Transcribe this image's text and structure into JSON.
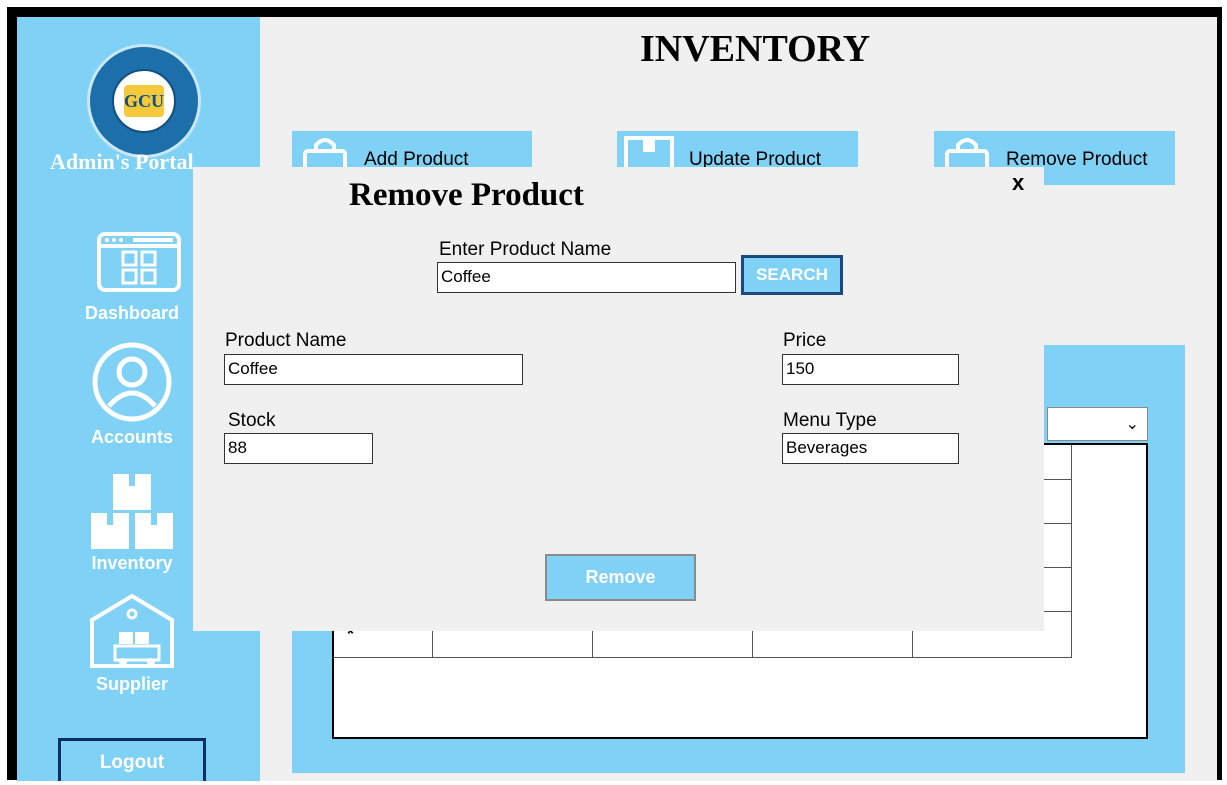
{
  "app": {
    "title": "INVENTORY"
  },
  "sidebar": {
    "portal_title": "Admin's Portal",
    "logo_text": "GCU",
    "items": [
      {
        "label": "Dashboard",
        "icon": "dashboard-icon"
      },
      {
        "label": "Accounts",
        "icon": "user-account-icon"
      },
      {
        "label": "Inventory",
        "icon": "boxes-icon"
      },
      {
        "label": "Supplier",
        "icon": "warehouse-truck-icon"
      }
    ],
    "logout_label": "Logout"
  },
  "toolbar": {
    "add_product": "Add Product",
    "update_product": "Update Product",
    "remove_product": "Remove Product"
  },
  "dialog": {
    "title": "Remove Product",
    "close": "x",
    "search_label": "Enter Product Name",
    "search_value": "Coffee",
    "search_button": "SEARCH",
    "product_name_label": "Product Name",
    "product_name_value": "Coffee",
    "price_label": "Price",
    "price_value": "150",
    "stock_label": "Stock",
    "stock_value": "88",
    "menu_type_label": "Menu Type",
    "menu_type_value": "Beverages",
    "remove_button": "Remove"
  },
  "grid": {
    "new_row_marker": "*"
  },
  "colors": {
    "accent": "#7fd1f5",
    "dark_border": "#0b2f63"
  }
}
